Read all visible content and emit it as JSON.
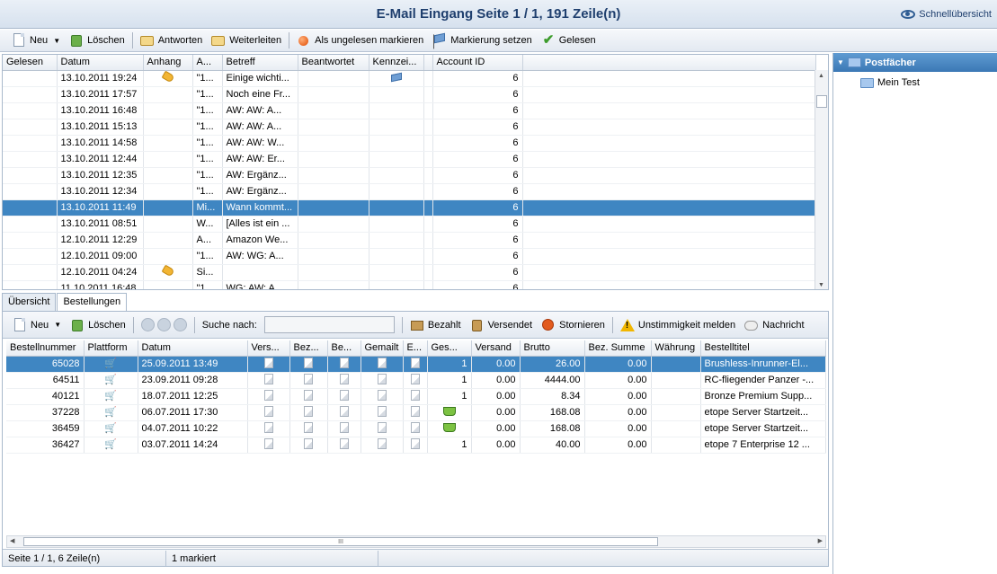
{
  "window": {
    "title": "E-Mail Eingang Seite 1 / 1, 191 Zeile(n)",
    "overview_label": "Schnellübersicht"
  },
  "toolbar": {
    "new": "Neu",
    "delete": "Löschen",
    "reply": "Antworten",
    "forward": "Weiterleiten",
    "mark_unread": "Als ungelesen markieren",
    "set_flag": "Markierung setzen",
    "read": "Gelesen"
  },
  "mail_table": {
    "headers": [
      "Gelesen",
      "Datum",
      "Anhang",
      "A...",
      "Betreff",
      "Beantwortet",
      "Kennzei...",
      "",
      "Account ID"
    ],
    "rows": [
      {
        "datum": "13.10.2011 19:24",
        "anhang": true,
        "a": "\"1...",
        "betreff": "Einige wichti...",
        "flag": true,
        "account": "6"
      },
      {
        "datum": "13.10.2011 17:57",
        "anhang": false,
        "a": "\"1...",
        "betreff": "Noch eine Fr...",
        "flag": false,
        "account": "6"
      },
      {
        "datum": "13.10.2011 16:48",
        "anhang": false,
        "a": "\"1...",
        "betreff": "AW: AW: A...",
        "flag": false,
        "account": "6"
      },
      {
        "datum": "13.10.2011 15:13",
        "anhang": false,
        "a": "\"1...",
        "betreff": "AW: AW: A...",
        "flag": false,
        "account": "6"
      },
      {
        "datum": "13.10.2011 14:58",
        "anhang": false,
        "a": "\"1...",
        "betreff": "AW: AW: W...",
        "flag": false,
        "account": "6"
      },
      {
        "datum": "13.10.2011 12:44",
        "anhang": false,
        "a": "\"1...",
        "betreff": "AW: AW: Er...",
        "flag": false,
        "account": "6"
      },
      {
        "datum": "13.10.2011 12:35",
        "anhang": false,
        "a": "\"1...",
        "betreff": "AW: Ergänz...",
        "flag": false,
        "account": "6"
      },
      {
        "datum": "13.10.2011 12:34",
        "anhang": false,
        "a": "\"1...",
        "betreff": "AW: Ergänz...",
        "flag": false,
        "account": "6"
      },
      {
        "datum": "13.10.2011 11:49",
        "anhang": false,
        "a": "Mi...",
        "betreff": "Wann kommt...",
        "flag": false,
        "account": "6",
        "selected": true
      },
      {
        "datum": "13.10.2011 08:51",
        "anhang": false,
        "a": "W...",
        "betreff": "[Alles ist ein ...",
        "flag": false,
        "account": "6"
      },
      {
        "datum": "12.10.2011 12:29",
        "anhang": false,
        "a": "A...",
        "betreff": "Amazon We...",
        "flag": false,
        "account": "6"
      },
      {
        "datum": "12.10.2011 09:00",
        "anhang": false,
        "a": "\"1...",
        "betreff": "AW: WG: A...",
        "flag": false,
        "account": "6"
      },
      {
        "datum": "12.10.2011 04:24",
        "anhang": true,
        "a": "Si...",
        "betreff": "",
        "flag": false,
        "account": "6"
      },
      {
        "datum": "11.10.2011 16:48",
        "anhang": false,
        "a": "\"1...",
        "betreff": "WG: AW: A...",
        "flag": false,
        "account": "6"
      }
    ]
  },
  "sidebar": {
    "root": "Postfächer",
    "items": [
      "Mein Test"
    ]
  },
  "tabs": [
    "Übersicht",
    "Bestellungen"
  ],
  "orders_toolbar": {
    "new": "Neu",
    "delete": "Löschen",
    "search_label": "Suche nach:",
    "search_value": "",
    "paid": "Bezahlt",
    "shipped": "Versendet",
    "cancel": "Stornieren",
    "report": "Unstimmigkeit melden",
    "message": "Nachricht"
  },
  "orders_table": {
    "headers": [
      "Bestellnummer",
      "Plattform",
      "Datum",
      "Vers...",
      "Bez...",
      "Be...",
      "Gemailt",
      "E...",
      "Ges...",
      "Versand",
      "Brutto",
      "Bez. Summe",
      "Währung",
      "Bestelltitel"
    ],
    "rows": [
      {
        "nr": "65028",
        "datum": "25.09.2011 13:49",
        "ges": "1",
        "basket": false,
        "versand": "0.00",
        "brutto": "26.00",
        "bez": "0.00",
        "waehrung": "",
        "titel": "Brushless-Inrunner-El...",
        "selected": true
      },
      {
        "nr": "64511",
        "datum": "23.09.2011 09:28",
        "ges": "1",
        "basket": false,
        "versand": "0.00",
        "brutto": "4444.00",
        "bez": "0.00",
        "waehrung": "",
        "titel": "RC-fliegender Panzer -..."
      },
      {
        "nr": "40121",
        "datum": "18.07.2011 12:25",
        "ges": "1",
        "basket": false,
        "versand": "0.00",
        "brutto": "8.34",
        "bez": "0.00",
        "waehrung": "",
        "titel": "Bronze Premium Supp..."
      },
      {
        "nr": "37228",
        "datum": "06.07.2011 17:30",
        "ges": "",
        "basket": true,
        "versand": "0.00",
        "brutto": "168.08",
        "bez": "0.00",
        "waehrung": "",
        "titel": "etope Server Startzeit..."
      },
      {
        "nr": "36459",
        "datum": "04.07.2011 10:22",
        "ges": "",
        "basket": true,
        "versand": "0.00",
        "brutto": "168.08",
        "bez": "0.00",
        "waehrung": "",
        "titel": "etope Server Startzeit..."
      },
      {
        "nr": "36427",
        "datum": "03.07.2011 14:24",
        "ges": "1",
        "basket": false,
        "versand": "0.00",
        "brutto": "40.00",
        "bez": "0.00",
        "waehrung": "",
        "titel": "etope 7 Enterprise 12 ..."
      }
    ]
  },
  "status": {
    "page": "Seite 1 / 1, 6 Zeile(n)",
    "marked": "1 markiert"
  },
  "hscroll_label": "III"
}
